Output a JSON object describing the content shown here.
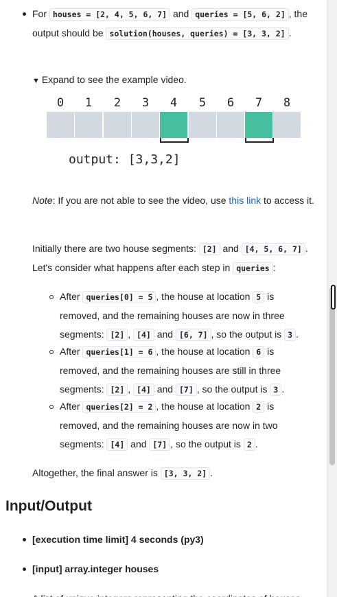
{
  "example": {
    "prefix_for": "For ",
    "houses_code": "houses = [2, 4, 5, 6, 7]",
    "and1": " and ",
    "queries_code": "queries = [5, 6, 2]",
    "suffix1": ", the output should be ",
    "solution_code": "solution(houses, queries) = [3, 3, 2]",
    "end": "."
  },
  "expander": {
    "label": "Expand to see the example video."
  },
  "video": {
    "indices": [
      "0",
      "1",
      "2",
      "3",
      "4",
      "5",
      "6",
      "7",
      "8"
    ],
    "highlighted": [
      4,
      7
    ],
    "output_text": "output: [3,3,2]"
  },
  "note": {
    "label": "Note",
    "text1": ": If you are not able to see the video, use ",
    "link": "this link",
    "text2": " to access it."
  },
  "initially": {
    "text1": "Initially there are two house segments: ",
    "seg1": "[2]",
    "and": " and ",
    "seg2": "[4, 5, 6, 7]",
    "text2": ". Let's consider what happens after each step in ",
    "queries": "queries",
    "text3": ":"
  },
  "steps": [
    {
      "after": "After ",
      "q": "queries[0] = 5",
      "mid": ", the house at location ",
      "loc": "5",
      "rest": " is removed, and the remaining houses are now in three segments: ",
      "segs": [
        "[2]",
        "[4]",
        "[6, 7]"
      ],
      "out": ", so the output is ",
      "val": "3",
      "end": "."
    },
    {
      "after": "After ",
      "q": "queries[1] = 6",
      "mid": ", the house at location ",
      "loc": "6",
      "rest": " is removed, and the remaining houses are still in three segments: ",
      "segs": [
        "[2]",
        "[4]",
        "[7]"
      ],
      "out": ", so the output is ",
      "val": "3",
      "end": "."
    },
    {
      "after": "After ",
      "q": "queries[2] = 2",
      "mid": ", the house at location ",
      "loc": "2",
      "rest": " is removed, and the remaining houses are now in two segments: ",
      "segs": [
        "[4]",
        "[7]"
      ],
      "out": ", so the output is ",
      "val": "2",
      "end": "."
    }
  ],
  "altogether": {
    "text": "Altogether, the final answer is ",
    "answer": "[3, 3, 2]",
    "end": "."
  },
  "io": {
    "heading": "Input/Output",
    "time_limit": "[execution time limit] 4 seconds (py3)",
    "input_houses": "[input] array.integer houses",
    "desc_partial": "A list of unique integers representing the coordinates of houses"
  }
}
